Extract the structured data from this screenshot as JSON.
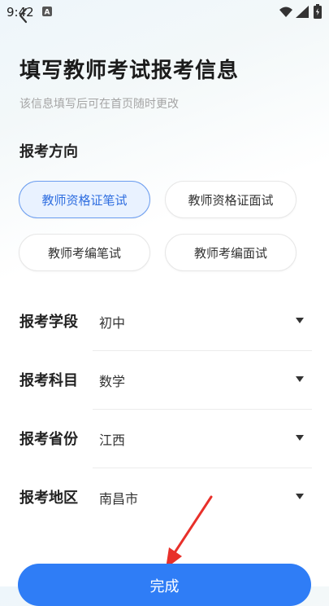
{
  "status_bar": {
    "time": "9:42"
  },
  "header": {
    "title": "填写教师考试报考信息",
    "subtitle": "该信息填写后可在首页随时更改"
  },
  "exam_direction": {
    "label": "报考方向",
    "selected_index": 0,
    "options": [
      "教师资格证笔试",
      "教师资格证面试",
      "教师考编笔试",
      "教师考编面试"
    ]
  },
  "fields": [
    {
      "label": "报考学段",
      "value": "初中"
    },
    {
      "label": "报考科目",
      "value": "数学"
    },
    {
      "label": "报考省份",
      "value": "江西"
    },
    {
      "label": "报考地区",
      "value": "南昌市"
    }
  ],
  "done_button": {
    "label": "完成"
  },
  "colors": {
    "accent": "#2f7df6",
    "selected_bg": "#e9f2ff",
    "arrow": "#e8302a"
  }
}
